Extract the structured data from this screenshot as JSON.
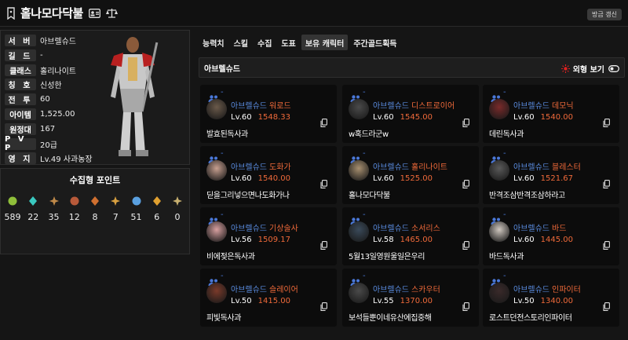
{
  "header": {
    "title": "홀나모다닥불",
    "refresh_label": "방금 갱신"
  },
  "profile": {
    "rows": [
      {
        "label": "서 버",
        "value": "아브렐슈드"
      },
      {
        "label": "길 드",
        "value": "-"
      },
      {
        "label": "클래스",
        "value": "홀리나이트"
      },
      {
        "label": "칭 호",
        "value": "신성한"
      },
      {
        "label": "전 투",
        "value": "60"
      },
      {
        "label": "아이템",
        "value": "1,525.00"
      },
      {
        "label": "원정대",
        "value": "167"
      },
      {
        "label": "P V P",
        "value": "20급"
      },
      {
        "label": "영 지",
        "value": "Lv.49 사과농장"
      }
    ]
  },
  "collect": {
    "title": "수집형 포인트",
    "items": [
      {
        "icon": "mokoko-seed-icon",
        "count": "589",
        "color": "#8fbf3a"
      },
      {
        "icon": "island-heart-icon",
        "count": "22",
        "color": "#3ac9c0"
      },
      {
        "icon": "great-art-icon",
        "count": "35",
        "color": "#c08a4a"
      },
      {
        "icon": "giant-heart-icon",
        "count": "12",
        "color": "#b85a3a"
      },
      {
        "icon": "ignea-token-icon",
        "count": "8",
        "color": "#d07030"
      },
      {
        "icon": "sea-bounty-icon",
        "count": "7",
        "color": "#d8a040"
      },
      {
        "icon": "world-tree-leaf-icon",
        "count": "51",
        "color": "#5aa0e0"
      },
      {
        "icon": "orpheus-star-icon",
        "count": "6",
        "color": "#e0a030"
      },
      {
        "icon": "omnium-star-icon",
        "count": "0",
        "color": "#c8b070"
      }
    ]
  },
  "tabs": [
    "능력치",
    "스킬",
    "수집",
    "도표",
    "보유 캐릭터",
    "주간골드획득"
  ],
  "active_tab": 4,
  "section": {
    "title": "아브렐슈드",
    "toggle_label": "외형 보기"
  },
  "characters": [
    {
      "server": "아브렐슈드",
      "class": "워로드",
      "level": "Lv.60",
      "item_level": "1548.33",
      "name": "발효된독사과",
      "tone": "#6b5a4a"
    },
    {
      "server": "아브렐슈드",
      "class": "디스트로이어",
      "level": "Lv.60",
      "item_level": "1545.00",
      "name": "w혹드라군w",
      "tone": "#4a4a4a"
    },
    {
      "server": "아브렐슈드",
      "class": "데모닉",
      "level": "Lv.60",
      "item_level": "1540.00",
      "name": "데린독사과",
      "tone": "#7a2a2a"
    },
    {
      "server": "아브렐슈드",
      "class": "도화가",
      "level": "Lv.60",
      "item_level": "1540.00",
      "name": "딛을그리넣으면나도화가나",
      "tone": "#c8a090"
    },
    {
      "server": "아브렐슈드",
      "class": "홀리나이트",
      "level": "Lv.60",
      "item_level": "1525.00",
      "name": "홀나모다닥불",
      "tone": "#a89070"
    },
    {
      "server": "아브렐슈드",
      "class": "블레스터",
      "level": "Lv.60",
      "item_level": "1521.67",
      "name": "반격조삼반격조삼하라고",
      "tone": "#5a5a5a"
    },
    {
      "server": "아브렐슈드",
      "class": "기상술사",
      "level": "Lv.56",
      "item_level": "1509.17",
      "name": "비에젖은독사과",
      "tone": "#d8a0a0"
    },
    {
      "server": "아브렐슈드",
      "class": "소서리스",
      "level": "Lv.58",
      "item_level": "1465.00",
      "name": "5월13일영원울일은우리",
      "tone": "#3a4a5a"
    },
    {
      "server": "아브렐슈드",
      "class": "바드",
      "level": "Lv.60",
      "item_level": "1445.00",
      "name": "바드독사과",
      "tone": "#d0c8c0"
    },
    {
      "server": "아브렐슈드",
      "class": "슬레이어",
      "level": "Lv.50",
      "item_level": "1415.00",
      "name": "피빛독사과",
      "tone": "#7a3a2a"
    },
    {
      "server": "아브렐슈드",
      "class": "스카우터",
      "level": "Lv.55",
      "item_level": "1370.00",
      "name": "보석들뿐이네유산에집중해",
      "tone": "#4a4a4a"
    },
    {
      "server": "아브렐슈드",
      "class": "인파이터",
      "level": "Lv.50",
      "item_level": "1340.00",
      "name": "로스트던전스토리인파이터",
      "tone": "#3a2a2a"
    }
  ],
  "colors": {
    "server": "#5a8ce0",
    "accent": "#f06a3a",
    "card_bg": "#0c0c0c"
  }
}
